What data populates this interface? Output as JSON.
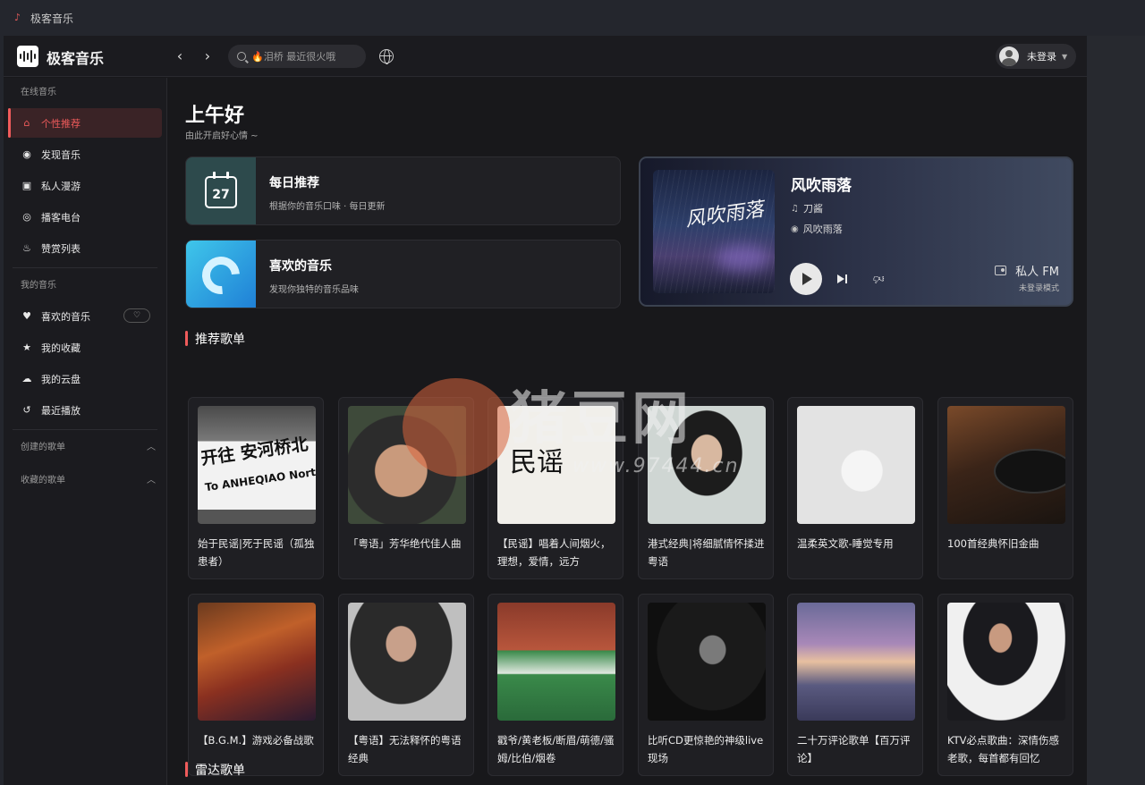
{
  "window": {
    "title": "极客音乐"
  },
  "topbar": {
    "app_name": "极客音乐",
    "back_label": "‹",
    "forward_label": "›",
    "search_placeholder": "🔥泪桥 最近很火哦",
    "user_name": "未登录"
  },
  "sidebar": {
    "online_section": "在线音乐",
    "online_items": [
      {
        "label": "个性推荐",
        "icon": "home-icon",
        "active": true
      },
      {
        "label": "发现音乐",
        "icon": "compass-icon"
      },
      {
        "label": "私人漫游",
        "icon": "radio-icon"
      },
      {
        "label": "播客电台",
        "icon": "podcast-icon"
      },
      {
        "label": "赞赏列表",
        "icon": "flame-icon"
      }
    ],
    "my_section": "我的音乐",
    "my_items": [
      {
        "label": "喜欢的音乐",
        "icon": "heart-icon"
      },
      {
        "label": "我的收藏",
        "icon": "star-icon"
      },
      {
        "label": "我的云盘",
        "icon": "cloud-icon"
      },
      {
        "label": "最近播放",
        "icon": "history-icon"
      }
    ],
    "created_section": "创建的歌单",
    "collected_section": "收藏的歌单"
  },
  "main": {
    "greeting": "上午好",
    "greeting_sub": "由此开启好心情 ~",
    "daily": {
      "title": "每日推荐",
      "subtitle": "根据你的音乐口味 · 每日更新",
      "day": "27"
    },
    "liked": {
      "title": "喜欢的音乐",
      "subtitle": "发现你独特的音乐品味"
    },
    "fm": {
      "song": "风吹雨落",
      "artist": "刀酱",
      "album": "风吹雨落",
      "cover_text": "风吹雨落",
      "label": "私人 FM",
      "sub": "未登录模式"
    },
    "recommend_title": "推荐歌单",
    "radar_title": "雷达歌单",
    "playlists": [
      {
        "name": "始于民谣|死于民谣（孤独患者）"
      },
      {
        "name": "「粤语」芳华绝代佳人曲"
      },
      {
        "name": "【民谣】唱着人间烟火，理想，爱情，远方"
      },
      {
        "name": "港式经典|将细腻情怀揉进粤语"
      },
      {
        "name": "温柔英文歌-睡觉专用"
      },
      {
        "name": "100首经典怀旧金曲"
      },
      {
        "name": "【B.G.M.】游戏必备战歌"
      },
      {
        "name": "【粤语】无法释怀的粤语经典"
      },
      {
        "name": "戳爷/黄老板/断眉/萌德/骚姆/比伯/烟卷"
      },
      {
        "name": "比听CD更惊艳的神级live现场"
      },
      {
        "name": "二十万评论歌单【百万评论】"
      },
      {
        "name": "KTV必点歌曲：深情伤感老歌，每首都有回忆"
      }
    ],
    "cover1_text": {
      "line1": "开往 安河桥北",
      "line2": "To ANHEQIAO North"
    },
    "cover3_text": "民谣"
  },
  "watermark": {
    "text": "猪豆网",
    "url": "www.97444.cn"
  }
}
